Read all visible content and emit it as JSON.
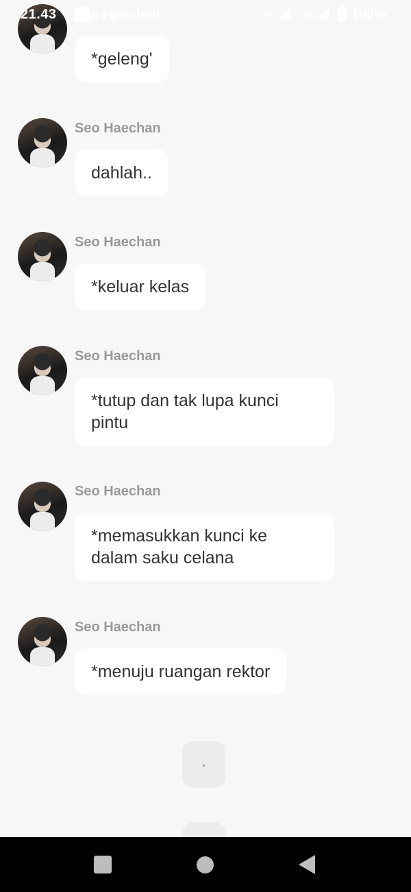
{
  "status_bar": {
    "time": "21.43",
    "signal_1": "4G",
    "signal_2": "4G",
    "battery": "100%"
  },
  "chat": {
    "top_sender_partial": "o Haechan",
    "messages": [
      {
        "sender": "",
        "text": "*geleng'"
      },
      {
        "sender": "Seo Haechan",
        "text": "dahlah.."
      },
      {
        "sender": "Seo Haechan",
        "text": "*keluar kelas"
      },
      {
        "sender": "Seo Haechan",
        "text": "*tutup dan tak lupa kunci pintu"
      },
      {
        "sender": "Seo Haechan",
        "text": "*memasukkan kunci ke dalam saku celana"
      },
      {
        "sender": "Seo Haechan",
        "text": "*menuju ruangan rektor"
      }
    ],
    "typing_indicator": "."
  },
  "nav": {
    "recents_icon": "square-icon",
    "home_icon": "circle-icon",
    "back_icon": "triangle-back-icon"
  }
}
